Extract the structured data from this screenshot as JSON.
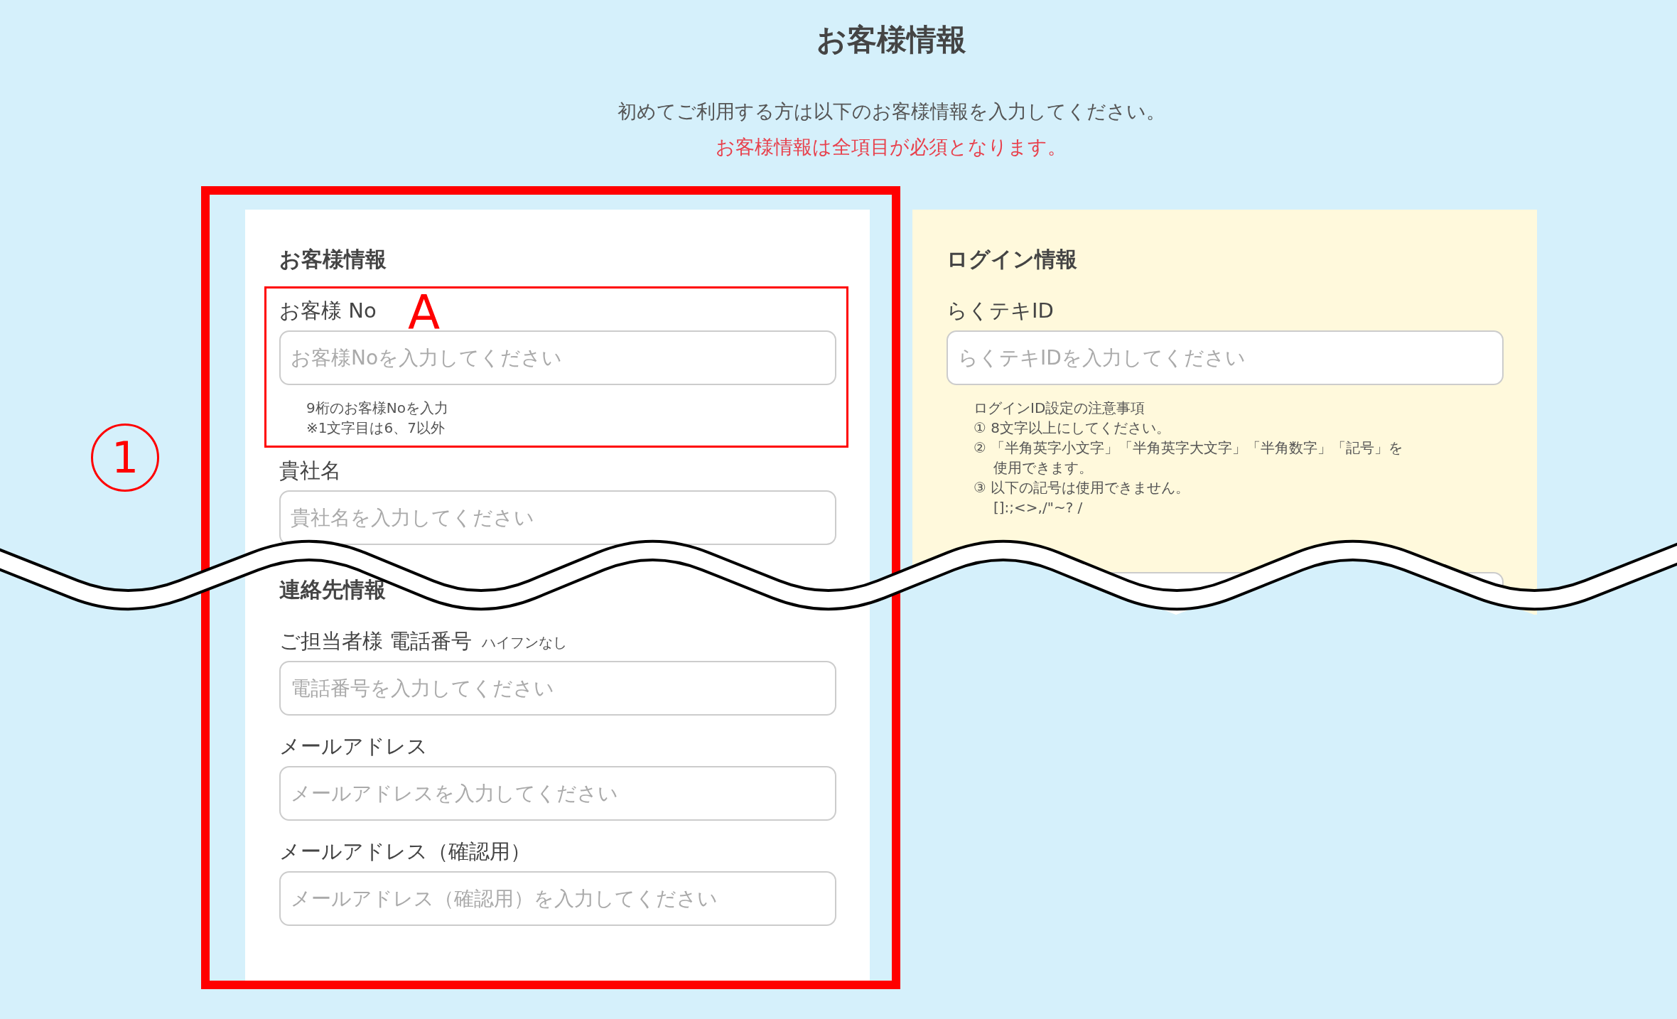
{
  "title": "お客様情報",
  "intro": [
    {
      "text": "初めてご利用する方は以下のお客様情報を入力してください。",
      "kind": "normal"
    },
    {
      "text": "お客様情報は全項目が必須となります。",
      "kind": "required"
    }
  ],
  "forms": [
    {
      "kind": "customer",
      "cut_by_break": false,
      "items": [
        {
          "kind": "heading",
          "text": "お客様情報"
        },
        {
          "kind": "field",
          "label": "お客様 No",
          "placeholder": "お客様Noを入力してください",
          "notes": [
            {
              "text": "9桁のお客様Noを入力",
              "indent": false
            },
            {
              "text": "※1文字目は6、7以外",
              "indent": false
            }
          ]
        },
        {
          "kind": "field",
          "label": "貴社名",
          "placeholder": "貴社名を入力してください"
        },
        {
          "kind": "heading",
          "text": "連絡先情報"
        },
        {
          "kind": "field",
          "label": "ご担当者様 電話番号",
          "hint": "ハイフンなし",
          "placeholder": "電話番号を入力してください"
        },
        {
          "kind": "field",
          "label": "メールアドレス",
          "placeholder": "メールアドレスを入力してください"
        },
        {
          "kind": "field",
          "label": "メールアドレス（確認用）",
          "placeholder": "メールアドレス（確認用）を入力してください"
        }
      ]
    },
    {
      "kind": "login",
      "cut_by_break": true,
      "items": [
        {
          "kind": "heading",
          "text": "ログイン情報"
        },
        {
          "kind": "field",
          "label": "らくテキID",
          "placeholder": "らくテキIDを入力してください",
          "notes": [
            {
              "text": "ログインID設定の注意事項",
              "indent": false
            },
            {
              "text": "① 8文字以上にしてください。",
              "indent": false
            },
            {
              "text": "② 「半角英字小文字」「半角英字大文字」「半角数字」「記号」を",
              "indent": false
            },
            {
              "text": "使用できます。",
              "indent": true
            },
            {
              "text": "③ 以下の記号は使用できません。",
              "indent": false
            },
            {
              "text": "[]:;<>,/\"~? /",
              "indent": true
            }
          ]
        },
        {
          "kind": "field"
        }
      ]
    }
  ],
  "annotations": {
    "marker": "A",
    "step": "1"
  }
}
